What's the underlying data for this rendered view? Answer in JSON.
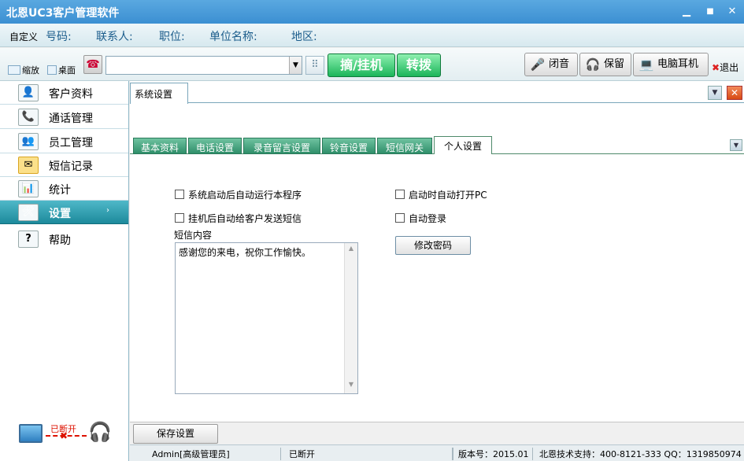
{
  "titlebar": {
    "title": "北恩UC3客户管理软件",
    "min": "▁",
    "restore": "■",
    "close": "✕"
  },
  "infobar": {
    "custom": "自定义",
    "fields": [
      "号码:",
      "联系人:",
      "职位:",
      "单位名称:",
      "地区:"
    ]
  },
  "toolbar": {
    "zoom_label": "缩放",
    "desktop_label": "桌面",
    "phone_icon": "☎",
    "combo_arrow": "▼",
    "dial_grid": "⠿",
    "pickup_label": "摘/挂机",
    "transfer_label": "转拨",
    "mute_label": "闭音",
    "hold_label": "保留",
    "pc_headset_label": "电脑耳机",
    "exit_label": "退出",
    "exit_x": "✖"
  },
  "sidebar": {
    "items": [
      {
        "label": "客户资料",
        "icon": "👤"
      },
      {
        "label": "通话管理",
        "icon": "📞"
      },
      {
        "label": "员工管理",
        "icon": "👥"
      },
      {
        "label": "短信记录",
        "icon": "✉"
      },
      {
        "label": "统计",
        "icon": "📊"
      },
      {
        "label": "设置",
        "icon": "🛠"
      },
      {
        "label": "帮助",
        "icon": "?"
      }
    ],
    "arrow": "›",
    "connection": {
      "status": "已断开",
      "x": "✖",
      "headset": "🎧"
    }
  },
  "main": {
    "tab_title": "系统设置",
    "min_btn": "▼",
    "close_btn": "✕",
    "subtabs": [
      "基本资料",
      "电话设置",
      "录音留言设置",
      "铃音设置",
      "短信网关",
      "个人设置"
    ],
    "subtab_arrow": "▼",
    "options": {
      "auto_run": "系统启动后自动运行本程序",
      "auto_sms": "挂机后自动给客户发送短信",
      "auto_open_pc": "启动时自动打开PC",
      "auto_login": "自动登录"
    },
    "sms_label": "短信内容",
    "sms_text": "感谢您的来电，祝你工作愉快。",
    "scroll_up": "▲",
    "scroll_down": "▼",
    "change_pwd": "修改密码",
    "save_btn": "保存设置"
  },
  "statusbar": {
    "user": "Admin[高级管理员]",
    "status": "已断开",
    "version": "版本号：2015.01",
    "support": "北恩技术支持：400-8121-333 QQ：1319850974"
  }
}
